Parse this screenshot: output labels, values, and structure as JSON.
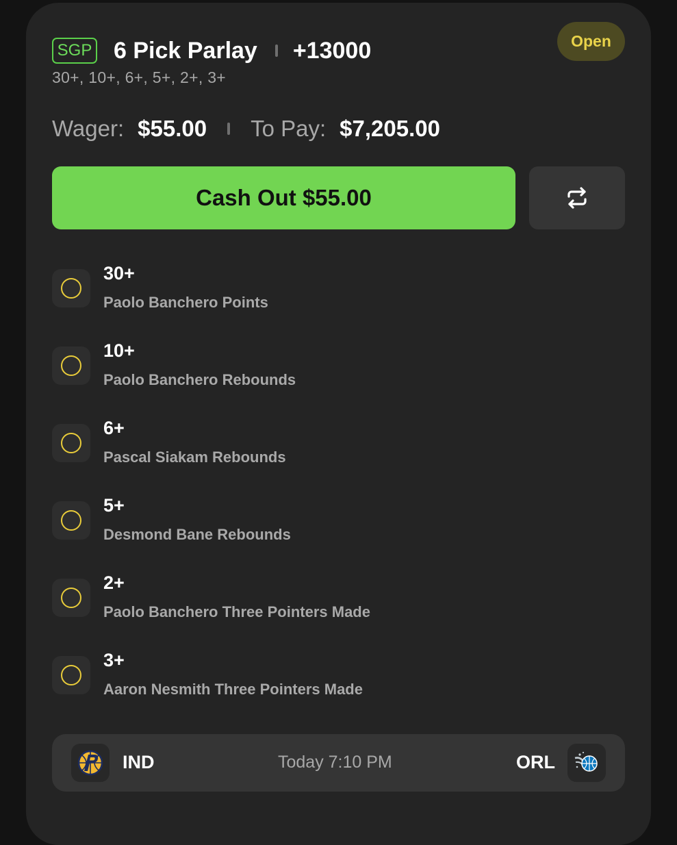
{
  "bet": {
    "badge": "SGP",
    "title": "6 Pick Parlay",
    "odds": "+13000",
    "legs_summary": "30+, 10+, 6+, 5+, 2+, 3+",
    "status": "Open"
  },
  "money": {
    "wager_label": "Wager:",
    "wager_value": "$55.00",
    "to_pay_label": "To Pay:",
    "to_pay_value": "$7,205.00"
  },
  "actions": {
    "cash_out_label": "Cash Out $55.00",
    "repeat_icon": "repeat-icon"
  },
  "legs": [
    {
      "line": "30+",
      "desc": "Paolo Banchero Points",
      "status_icon": "pending-circle-icon"
    },
    {
      "line": "10+",
      "desc": "Paolo Banchero Rebounds",
      "status_icon": "pending-circle-icon"
    },
    {
      "line": "6+",
      "desc": "Pascal Siakam Rebounds",
      "status_icon": "pending-circle-icon"
    },
    {
      "line": "5+",
      "desc": "Desmond Bane Rebounds",
      "status_icon": "pending-circle-icon"
    },
    {
      "line": "2+",
      "desc": "Paolo Banchero Three Pointers Made",
      "status_icon": "pending-circle-icon"
    },
    {
      "line": "3+",
      "desc": "Aaron Nesmith Three Pointers Made",
      "status_icon": "pending-circle-icon"
    }
  ],
  "game": {
    "home": "IND",
    "away": "ORL",
    "time": "Today 7:10 PM",
    "home_logo": "pacers-logo",
    "away_logo": "magic-logo"
  },
  "colors": {
    "background": "#131313",
    "card": "#242424",
    "accent_green": "#72d552",
    "pending_yellow": "#e9cc3a",
    "status_pill": "#4d4a22"
  }
}
